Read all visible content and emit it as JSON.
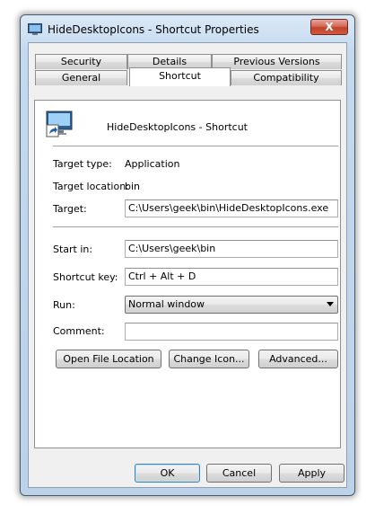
{
  "window": {
    "title": "HideDesktopIcons - Shortcut Properties",
    "close_label": "X"
  },
  "tabs": {
    "row1": [
      {
        "label": "Security"
      },
      {
        "label": "Details"
      },
      {
        "label": "Previous Versions"
      }
    ],
    "row2": [
      {
        "label": "General"
      },
      {
        "label": "Shortcut",
        "active": true
      },
      {
        "label": "Compatibility"
      }
    ]
  },
  "shortcut": {
    "name": "HideDesktopIcons - Shortcut",
    "target_type_label": "Target type:",
    "target_type_value": "Application",
    "target_location_label": "Target location:",
    "target_location_value": "bin",
    "target_label": "Target:",
    "target_value": "C:\\Users\\geek\\bin\\HideDesktopIcons.exe",
    "start_in_label": "Start in:",
    "start_in_value": "C:\\Users\\geek\\bin",
    "shortcut_key_label": "Shortcut key:",
    "shortcut_key_value": "Ctrl + Alt + D",
    "run_label": "Run:",
    "run_value": "Normal window",
    "comment_label": "Comment:",
    "comment_value": ""
  },
  "actions": {
    "open_file_location": "Open File Location",
    "change_icon": "Change Icon...",
    "advanced": "Advanced..."
  },
  "footer": {
    "ok": "OK",
    "cancel": "Cancel",
    "apply": "Apply"
  },
  "icons": {
    "title": "shortcut-app-icon",
    "large": "shortcut-app-icon"
  },
  "colors": {
    "accent": "#3c7fb1",
    "close": "#c2412d"
  }
}
